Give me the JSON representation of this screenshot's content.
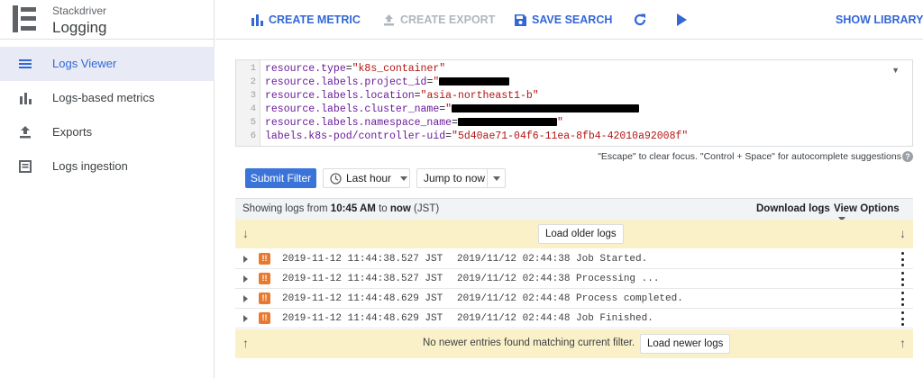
{
  "brand": {
    "small": "Stackdriver",
    "big": "Logging"
  },
  "sidebar": {
    "items": [
      {
        "label": "Logs Viewer",
        "icon": "list-icon",
        "active": true
      },
      {
        "label": "Logs-based metrics",
        "icon": "bar-chart-icon",
        "active": false
      },
      {
        "label": "Exports",
        "icon": "export-icon",
        "active": false
      },
      {
        "label": "Logs ingestion",
        "icon": "ingestion-icon",
        "active": false
      }
    ]
  },
  "toolbar": {
    "create_metric": "CREATE METRIC",
    "create_export": "CREATE EXPORT",
    "save_search": "SAVE SEARCH",
    "show_library": "SHOW LIBRARY",
    "refresh_icon": "refresh-icon",
    "play_icon": "play-icon"
  },
  "query": {
    "line_numbers": [
      "1",
      "2",
      "3",
      "4",
      "5",
      "6"
    ],
    "l1_key": "resource.type",
    "l1_val": "\"k8s_container\"",
    "l2_key": "resource.labels.project_id",
    "l2_val_open": "\"",
    "l3_key": "resource.labels.location",
    "l3_val": "\"asia-northeast1-b\"",
    "l4_key": "resource.labels.cluster_name",
    "l4_val_open": "\"",
    "l5_key": "resource.labels.namespace_name",
    "l5_val_close": "\"",
    "l6_key": "labels.k8s-pod/controller-uid",
    "l6_val": "\"5d40ae71-04f6-11ea-8fb4-42010a92008f\"",
    "eq": "="
  },
  "hint": "\"Escape\" to clear focus. \"Control + Space\" for autocomplete suggestions",
  "help_icon": "?",
  "filter": {
    "submit": "Submit Filter",
    "time_range": "Last hour",
    "jump": "Jump to now"
  },
  "results": {
    "showing_prefix": "Showing logs from ",
    "from_time": "10:45 AM",
    "to_word": " to ",
    "to_time": "now",
    "tz": " (JST)",
    "download": "Download logs",
    "view_options": "View Options"
  },
  "top_banner": {
    "load_older": "Load older logs"
  },
  "logs": [
    {
      "severity": "!!",
      "timestamp": "2019-11-12 11:44:38.527 JST",
      "message": "2019/11/12 02:44:38 Job Started."
    },
    {
      "severity": "!!",
      "timestamp": "2019-11-12 11:44:38.527 JST",
      "message": "2019/11/12 02:44:38 Processing ..."
    },
    {
      "severity": "!!",
      "timestamp": "2019-11-12 11:44:48.629 JST",
      "message": "2019/11/12 02:44:48 Process completed."
    },
    {
      "severity": "!!",
      "timestamp": "2019-11-12 11:44:48.629 JST",
      "message": "2019/11/12 02:44:48 Job Finished."
    }
  ],
  "bottom_banner": {
    "message": "No newer entries found matching current filter.",
    "load_newer": "Load newer logs"
  },
  "colors": {
    "accent": "#3367d6",
    "banner": "#fbf1c9",
    "severity": "#e8792f",
    "submit": "#3b74d9"
  }
}
